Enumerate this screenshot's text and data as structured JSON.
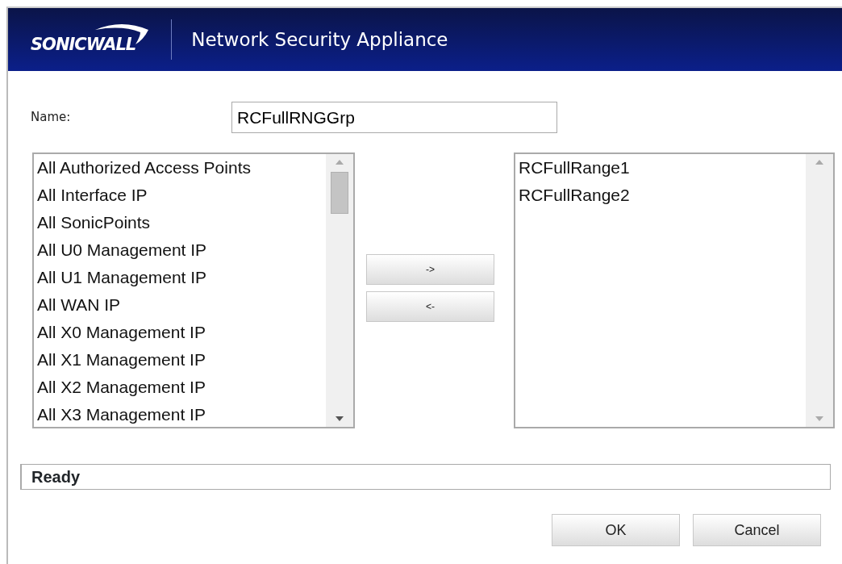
{
  "header": {
    "logo": "SONICWALL",
    "title": "Network Security Appliance"
  },
  "name_field": {
    "label": "Name:",
    "value": "RCFullRNGGrp"
  },
  "available_list": {
    "items": [
      "All Authorized Access Points",
      "All Interface IP",
      "All SonicPoints",
      "All U0 Management IP",
      "All U1 Management IP",
      "All WAN IP",
      "All X0 Management IP",
      "All X1 Management IP",
      "All X2 Management IP",
      "All X3 Management IP"
    ]
  },
  "move_buttons": [
    "->",
    "<-"
  ],
  "selected_list": {
    "items": [
      "RCFullRange1",
      "RCFullRange2"
    ]
  },
  "status_bar": "Ready",
  "buttons": [
    "OK",
    "Cancel"
  ]
}
